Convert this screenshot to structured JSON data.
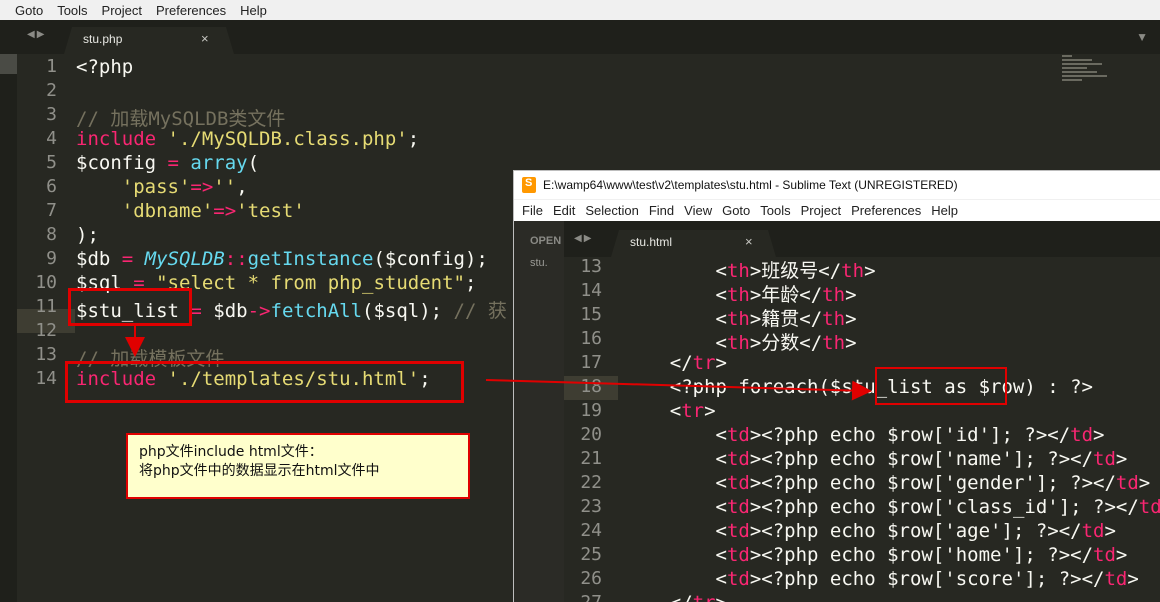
{
  "main_menu": [
    "Goto",
    "Tools",
    "Project",
    "Preferences",
    "Help"
  ],
  "editor1": {
    "tab": "stu.php",
    "close": "×",
    "lines": [
      {
        "n": "1"
      },
      {
        "n": "2"
      },
      {
        "n": "3"
      },
      {
        "n": "4"
      },
      {
        "n": "5"
      },
      {
        "n": "6"
      },
      {
        "n": "7"
      },
      {
        "n": "8"
      },
      {
        "n": "9"
      },
      {
        "n": "10"
      },
      {
        "n": "11"
      },
      {
        "n": "12"
      },
      {
        "n": "13"
      },
      {
        "n": "14"
      }
    ]
  },
  "note": {
    "line1": "php文件include html文件：",
    "line2": "将php文件中的数据显示在html文件中"
  },
  "window2": {
    "title": "E:\\wamp64\\www\\test\\v2\\templates\\stu.html - Sublime Text (UNREGISTERED)",
    "menu": [
      "File",
      "Edit",
      "Selection",
      "Find",
      "View",
      "Goto",
      "Tools",
      "Project",
      "Preferences",
      "Help"
    ],
    "sidebar_open": "OPEN",
    "sidebar_file": "stu.",
    "tab": "stu.html",
    "close": "×",
    "line_numbers": [
      "13",
      "14",
      "15",
      "16",
      "17",
      "18",
      "19",
      "20",
      "21",
      "22",
      "23",
      "24",
      "25",
      "26",
      "27"
    ]
  },
  "colors": {
    "keyword": "#f92672",
    "string": "#e6db74",
    "comment": "#75715e",
    "func": "#66d9ef",
    "annotation": "#e00000"
  }
}
